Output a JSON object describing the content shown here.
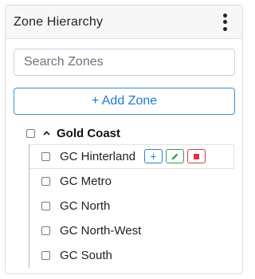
{
  "panel": {
    "title": "Zone Hierarchy"
  },
  "search": {
    "placeholder": "Search Zones",
    "value": ""
  },
  "add_zone": {
    "label": "+ Add Zone"
  },
  "tree": {
    "root": {
      "label": "Gold Coast",
      "expanded": true
    },
    "children": [
      {
        "label": "GC Hinterland",
        "hovered": true
      },
      {
        "label": "GC Metro"
      },
      {
        "label": "GC North"
      },
      {
        "label": "GC North-West"
      },
      {
        "label": "GC South"
      }
    ]
  },
  "row_actions": {
    "add": "+"
  },
  "colors": {
    "accent": "#1f7ad1",
    "edit": "#2e9e4f",
    "delete": "#d9363e"
  }
}
